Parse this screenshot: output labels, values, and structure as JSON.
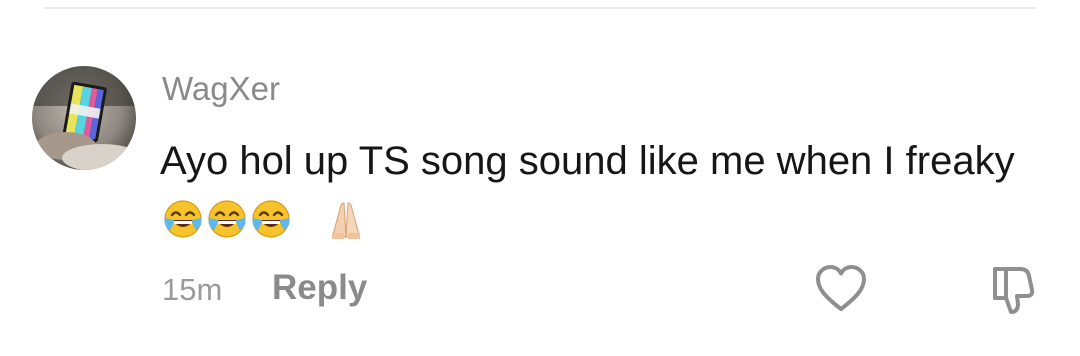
{
  "comment": {
    "username": "WagXer",
    "text": "Ayo hol up TS song sound like me when I freaky",
    "emojis": [
      "face-with-tears-of-joy",
      "face-with-tears-of-joy",
      "face-with-tears-of-joy",
      "folded-hands"
    ],
    "time": "15m",
    "reply_label": "Reply"
  },
  "icons": {
    "avatar": "avatar-image",
    "like": "heart-outline-icon",
    "dislike": "thumbs-down-outline-icon"
  },
  "colors": {
    "username": "#8a8a8a",
    "text": "#161616",
    "meta": "#9a9a9a"
  }
}
